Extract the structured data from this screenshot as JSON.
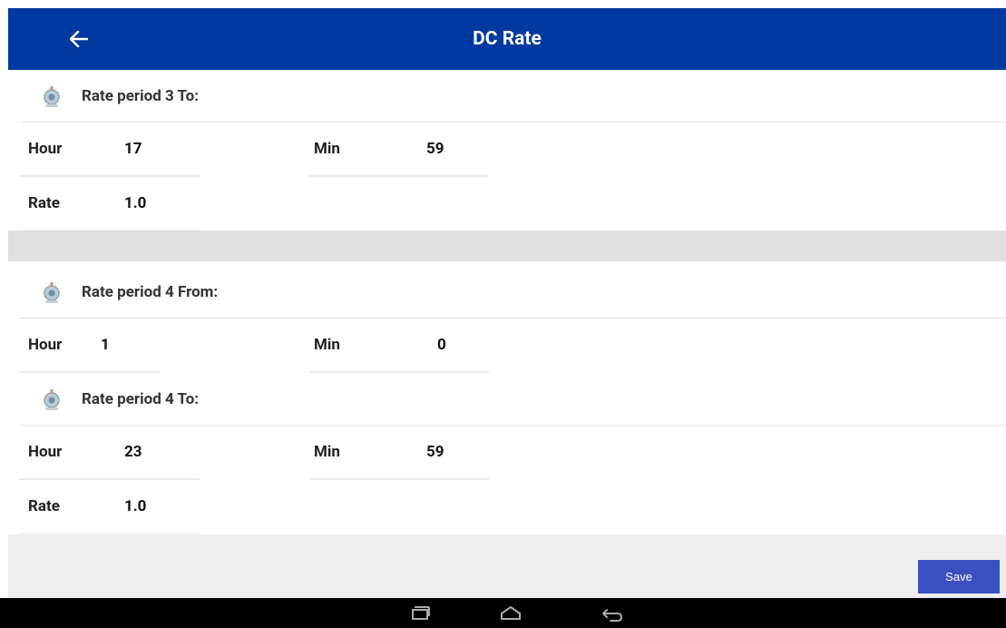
{
  "header": {
    "title": "DC Rate",
    "back_icon": "arrow-left-icon"
  },
  "sections": [
    {
      "heading": "Rate period 3 To:",
      "hour_label": "Hour",
      "hour_value": "17",
      "min_label": "Min",
      "min_value": "59",
      "rate_label": "Rate",
      "rate_value": "1.0"
    },
    {
      "heading": "Rate period 4 From:",
      "hour_label": "Hour",
      "hour_value": "1",
      "min_label": "Min",
      "min_value": "0"
    },
    {
      "heading": "Rate period 4 To:",
      "hour_label": "Hour",
      "hour_value": "23",
      "min_label": "Min",
      "min_value": "59",
      "rate_label": "Rate",
      "rate_value": "1.0"
    }
  ],
  "footer": {
    "save_label": "Save"
  },
  "navbar": {
    "icons": [
      "recent-apps-icon",
      "home-icon",
      "back-icon"
    ]
  },
  "colors": {
    "appbar": "#00399f",
    "save_button": "#3c4fc1"
  }
}
